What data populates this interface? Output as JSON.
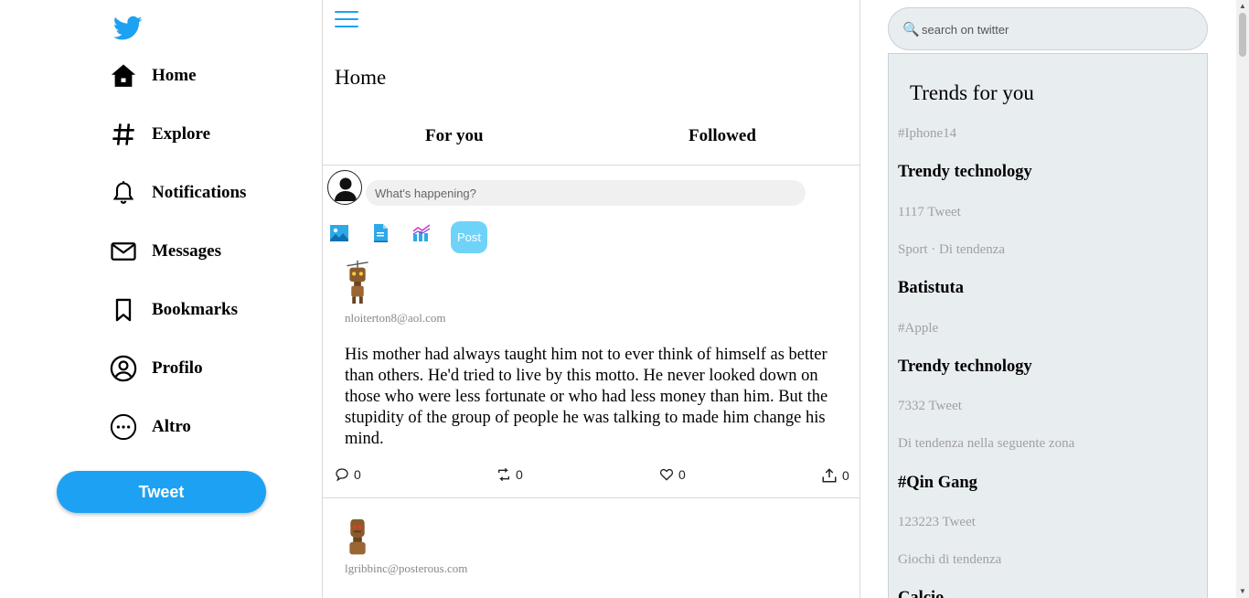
{
  "nav": {
    "items": [
      {
        "label": "Home",
        "icon": "home-icon"
      },
      {
        "label": "Explore",
        "icon": "hashtag-icon"
      },
      {
        "label": "Notifications",
        "icon": "bell-icon"
      },
      {
        "label": "Messages",
        "icon": "envelope-icon"
      },
      {
        "label": "Bookmarks",
        "icon": "bookmark-icon"
      },
      {
        "label": "Profilo",
        "icon": "user-circle-icon"
      },
      {
        "label": "Altro",
        "icon": "more-circle-icon"
      }
    ],
    "tweet_button": "Tweet"
  },
  "feed": {
    "title": "Home",
    "tabs": [
      "For you",
      "Followed"
    ],
    "composer": {
      "placeholder": "What's happening?",
      "post_label": "Post"
    },
    "tweets": [
      {
        "user": "nloiterton8@aol.com",
        "text": "His mother had always taught him not to ever think of himself as better than others. He'd tried to live by this motto. He never looked down on those who were less fortunate or who had less money than him. But the stupidity of the group of people he was talking to made him change his mind.",
        "replies": "0",
        "retweets": "0",
        "likes": "0",
        "shares": "0"
      },
      {
        "user": "lgribbinc@posterous.com"
      }
    ]
  },
  "search": {
    "placeholder": "search on twitter"
  },
  "trends": {
    "title": "Trends for you",
    "rows": [
      {
        "kind": "meta",
        "text": "#Iphone14"
      },
      {
        "kind": "name",
        "text": "Trendy technology"
      },
      {
        "kind": "meta",
        "text": "1117 Tweet"
      },
      {
        "kind": "meta",
        "text": "Sport · Di tendenza"
      },
      {
        "kind": "name",
        "text": "Batistuta"
      },
      {
        "kind": "meta",
        "text": "#Apple"
      },
      {
        "kind": "name",
        "text": "Trendy technology"
      },
      {
        "kind": "meta",
        "text": "7332 Tweet"
      },
      {
        "kind": "meta",
        "text": "Di tendenza nella seguente zona"
      },
      {
        "kind": "name",
        "text": "#Qin Gang"
      },
      {
        "kind": "meta",
        "text": "123223 Tweet"
      },
      {
        "kind": "meta",
        "text": "Giochi di tendenza"
      },
      {
        "kind": "name",
        "text": "Calcio"
      }
    ]
  },
  "colors": {
    "brand": "#1da1f2",
    "post_button": "#6fd3f7",
    "panel": "#e8edf0",
    "muted_text": "#a0a0a0"
  }
}
